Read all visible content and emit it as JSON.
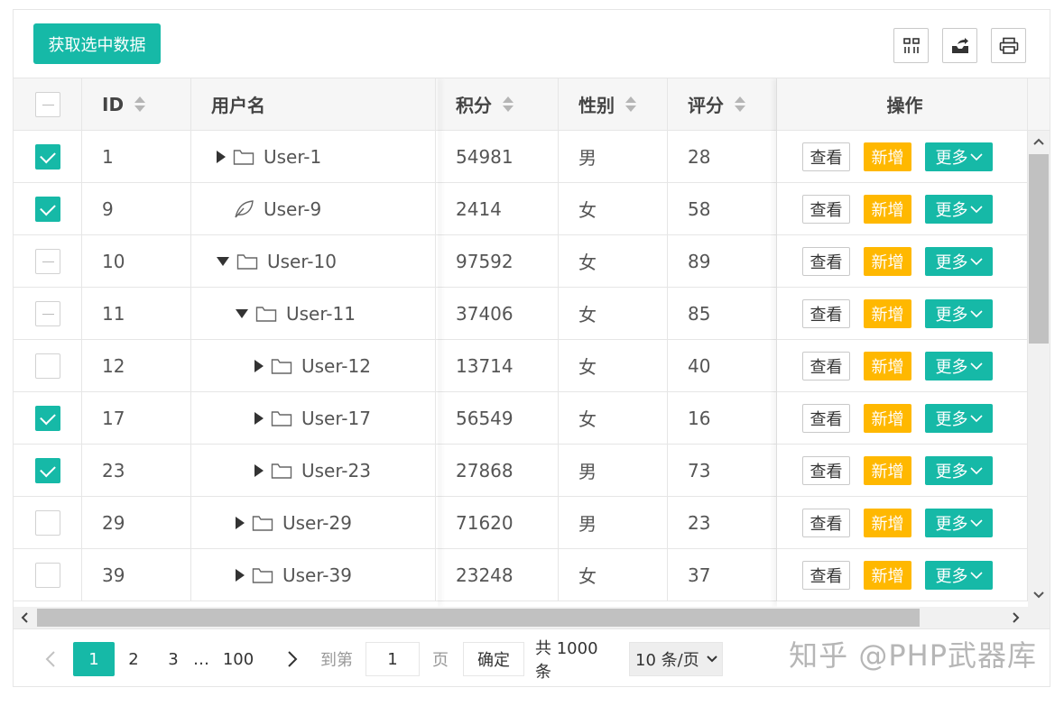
{
  "toolbar": {
    "get_selected_label": "获取选中数据",
    "icons": [
      "columns-filter-icon",
      "export-icon",
      "print-icon"
    ]
  },
  "columns": {
    "id": "ID",
    "username": "用户名",
    "score": "积分",
    "gender": "性别",
    "rating": "评分",
    "actions": "操作"
  },
  "actions": {
    "view": "查看",
    "add": "新增",
    "more": "更多"
  },
  "rows": [
    {
      "check": "checked",
      "id": "1",
      "name": "User-1",
      "level": 0,
      "node": "collapsed",
      "score": "54981",
      "gender": "男",
      "rating": "28"
    },
    {
      "check": "checked",
      "id": "9",
      "name": "User-9",
      "level": 0,
      "node": "leaf",
      "score": "2414",
      "gender": "女",
      "rating": "58"
    },
    {
      "check": "partial",
      "id": "10",
      "name": "User-10",
      "level": 0,
      "node": "expanded",
      "score": "97592",
      "gender": "女",
      "rating": "89"
    },
    {
      "check": "partial",
      "id": "11",
      "name": "User-11",
      "level": 1,
      "node": "expanded",
      "score": "37406",
      "gender": "女",
      "rating": "85"
    },
    {
      "check": "unchecked",
      "id": "12",
      "name": "User-12",
      "level": 2,
      "node": "collapsed",
      "score": "13714",
      "gender": "女",
      "rating": "40"
    },
    {
      "check": "checked",
      "id": "17",
      "name": "User-17",
      "level": 2,
      "node": "collapsed",
      "score": "56549",
      "gender": "女",
      "rating": "16"
    },
    {
      "check": "checked",
      "id": "23",
      "name": "User-23",
      "level": 2,
      "node": "collapsed",
      "score": "27868",
      "gender": "男",
      "rating": "73"
    },
    {
      "check": "unchecked",
      "id": "29",
      "name": "User-29",
      "level": 1,
      "node": "collapsed",
      "score": "71620",
      "gender": "男",
      "rating": "23"
    },
    {
      "check": "unchecked",
      "id": "39",
      "name": "User-39",
      "level": 1,
      "node": "collapsed",
      "score": "23248",
      "gender": "女",
      "rating": "37"
    }
  ],
  "pager": {
    "pages": [
      "1",
      "2",
      "3",
      "…",
      "100"
    ],
    "current": "1",
    "goto_label": "到第",
    "goto_value": "1",
    "page_unit": "页",
    "confirm": "确定",
    "total": "共 1000 条",
    "page_size": "10 条/页"
  },
  "watermark": "知乎 @PHP武器库",
  "colors": {
    "primary": "#16b9a7",
    "warning": "#ffb800",
    "border": "#e6e6e6",
    "header_bg": "#f6f6f6"
  }
}
